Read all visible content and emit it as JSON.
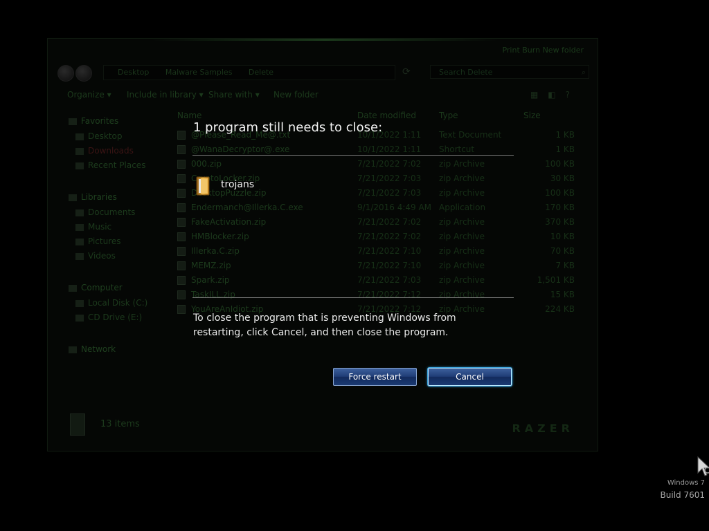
{
  "explorer": {
    "command_link": "Print    Burn    New folder",
    "address_segments": [
      "Desktop",
      "Malware Samples",
      "Delete"
    ],
    "search_placeholder": "Search Delete",
    "toolbar": {
      "organize": "Organize ▾",
      "include": "Include in library ▾",
      "share": "Share with ▾",
      "new_folder": "New folder"
    },
    "sidebar": {
      "favorites": "Favorites",
      "desktop": "Desktop",
      "downloads": "Downloads",
      "recent_places": "Recent Places",
      "libraries": "Libraries",
      "documents": "Documents",
      "music": "Music",
      "pictures": "Pictures",
      "videos": "Videos",
      "computer": "Computer",
      "local_disk": "Local Disk (C:)",
      "cd_drive": "CD Drive (E:)",
      "network": "Network"
    },
    "columns": {
      "name": "Name",
      "date": "Date modified",
      "type": "Type",
      "size": "Size"
    },
    "files": [
      {
        "name": "@Please_Read_Me@.txt",
        "date": "10/1/2022 1:11",
        "type": "Text Document",
        "size": "1 KB"
      },
      {
        "name": "@WanaDecryptor@.exe",
        "date": "10/1/2022 1:11",
        "type": "Shortcut",
        "size": "1 KB"
      },
      {
        "name": "000.zip",
        "date": "7/21/2022 7:02",
        "type": "zip Archive",
        "size": "100 KB"
      },
      {
        "name": "CryptoLocker.zip",
        "date": "7/21/2022 7:03",
        "type": "zip Archive",
        "size": "30 KB"
      },
      {
        "name": "DesktopPuzzle.zip",
        "date": "7/21/2022 7:03",
        "type": "zip Archive",
        "size": "100 KB"
      },
      {
        "name": "Endermanch@Illerka.C.exe",
        "date": "9/1/2016 4:49 AM",
        "type": "Application",
        "size": "170 KB"
      },
      {
        "name": "FakeActivation.zip",
        "date": "7/21/2022 7:02",
        "type": "zip Archive",
        "size": "370 KB"
      },
      {
        "name": "HMBlocker.zip",
        "date": "7/21/2022 7:02",
        "type": "zip Archive",
        "size": "10 KB"
      },
      {
        "name": "Illerka.C.zip",
        "date": "7/21/2022 7:10",
        "type": "zip Archive",
        "size": "70 KB"
      },
      {
        "name": "MEMZ.zip",
        "date": "7/21/2022 7:10",
        "type": "zip Archive",
        "size": "7 KB"
      },
      {
        "name": "Spark.zip",
        "date": "7/21/2022 7:03",
        "type": "zip Archive",
        "size": "1,501 KB"
      },
      {
        "name": "TaskILL.zip",
        "date": "7/21/2022 7:12",
        "type": "zip Archive",
        "size": "15 KB"
      },
      {
        "name": "YouAreAnIdiot.zip",
        "date": "7/21/2022 7:12",
        "type": "zip Archive",
        "size": "224 KB"
      }
    ],
    "status_count": "13 items",
    "brand": "RAZER"
  },
  "dialog": {
    "title": "1 program still needs to close:",
    "program_name": "trojans",
    "message": "To close the program that is preventing Windows from restarting, click Cancel, and then close the program.",
    "force_restart_label": "Force restart",
    "cancel_label": "Cancel"
  },
  "watermark": {
    "line1": "Windows 7",
    "line2": "Build 7601"
  },
  "colors": {
    "background": "#000000",
    "button_blue": "#1f3d76",
    "focus_glow": "#42b8ff",
    "dialog_text": "#f2f2f2"
  }
}
